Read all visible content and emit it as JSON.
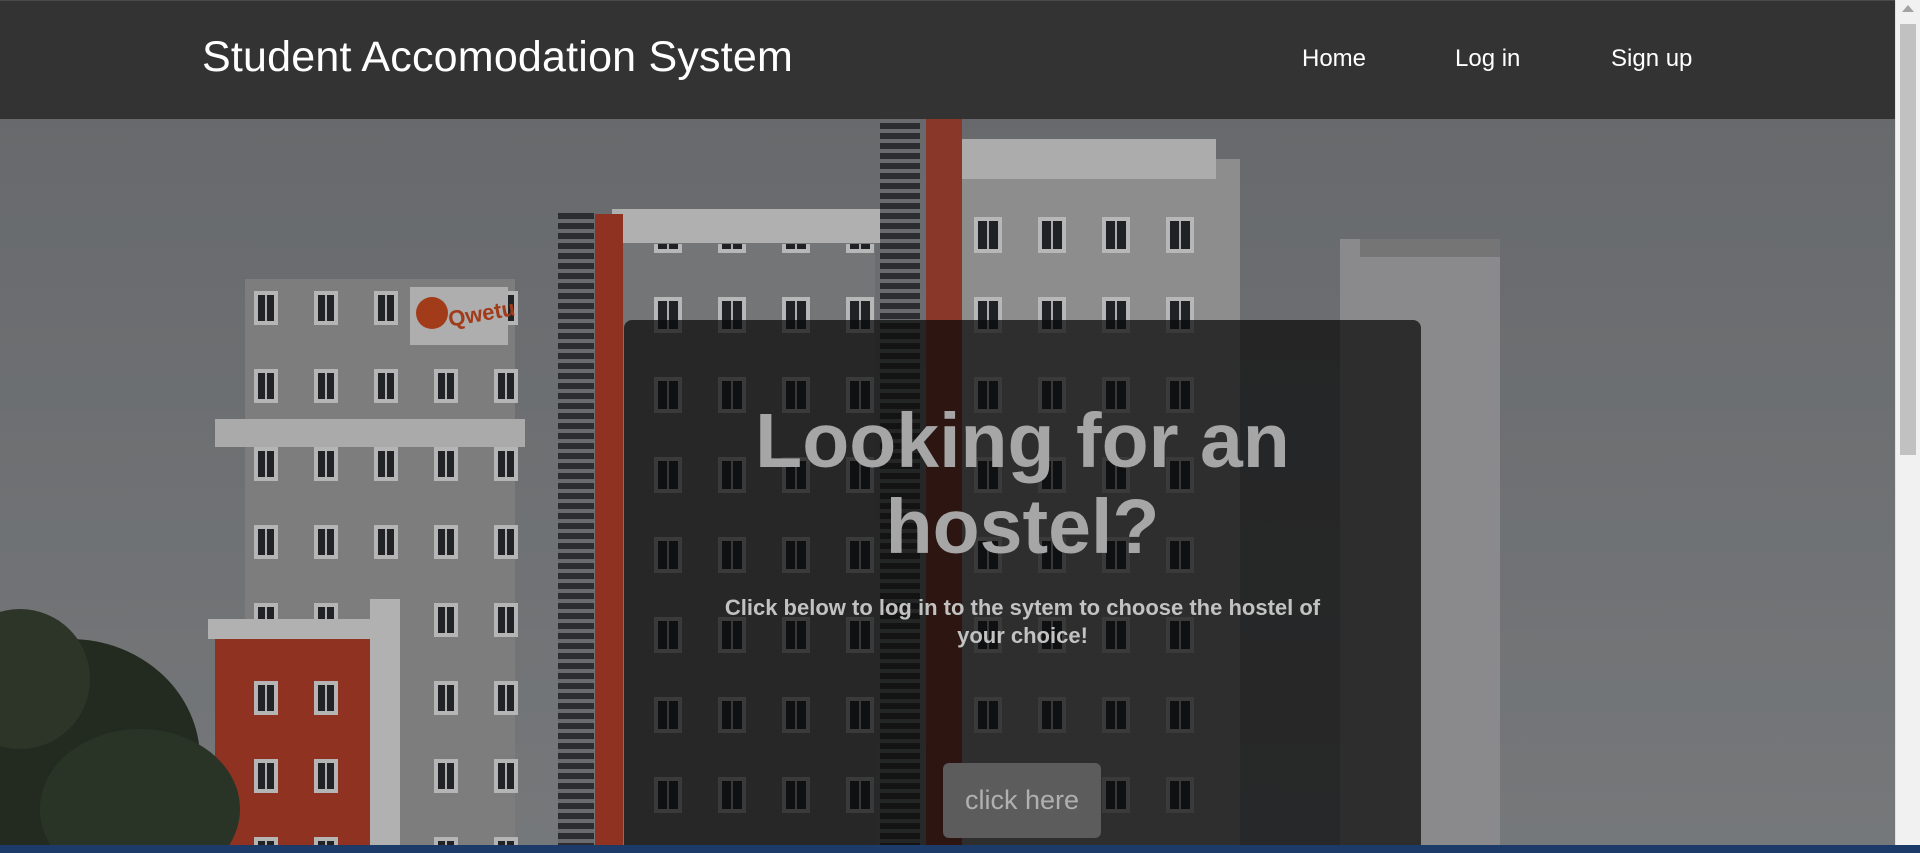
{
  "navbar": {
    "brand": "Student Accomodation System",
    "links": [
      {
        "label": "Home"
      },
      {
        "label": "Log in"
      },
      {
        "label": "Sign up"
      }
    ]
  },
  "hero": {
    "sign_text": "Qwetu",
    "title": "Looking for an hostel?",
    "subtitle": "Click below to log in to the sytem to choose the hostel of your choice!",
    "button_label": "click here"
  },
  "colors": {
    "navbar_bg": "#333333",
    "card_overlay": "#0a0a0a",
    "accent_red": "#c0432e"
  }
}
